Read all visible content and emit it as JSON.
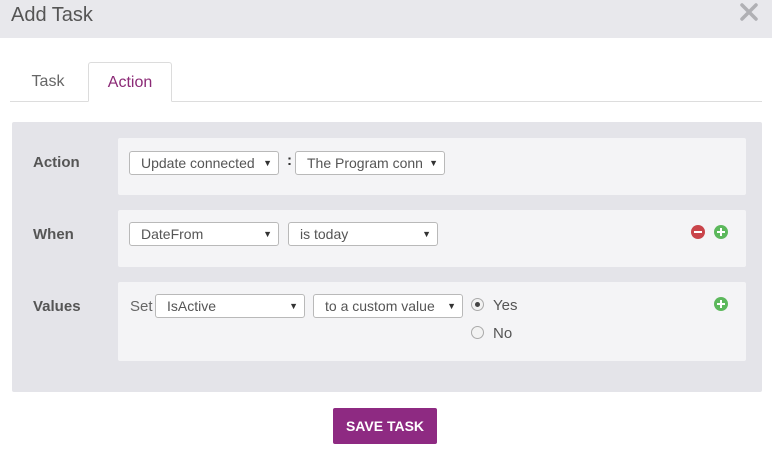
{
  "dialog": {
    "title": "Add Task"
  },
  "tabs": [
    {
      "label": "Task",
      "active": false
    },
    {
      "label": "Action",
      "active": true
    }
  ],
  "rows": {
    "action": {
      "label": "Action",
      "select1": "Update connected",
      "separator": ":",
      "select2": "The Program conn"
    },
    "when": {
      "label": "When",
      "field": "DateFrom",
      "condition": "is today"
    },
    "values": {
      "label": "Values",
      "set_label": "Set",
      "field": "IsActive",
      "mode": "to a custom value",
      "options": [
        {
          "label": "Yes",
          "checked": true
        },
        {
          "label": "No",
          "checked": false
        }
      ]
    }
  },
  "footer": {
    "save_label": "SAVE TASK"
  },
  "colors": {
    "accent": "#8b2a76",
    "remove": "#c9444a",
    "add": "#5cb85c"
  },
  "icons": {
    "close": "close-icon",
    "remove": "minus-circle-icon",
    "add": "plus-circle-icon",
    "dropdown": "caret-down-icon"
  }
}
